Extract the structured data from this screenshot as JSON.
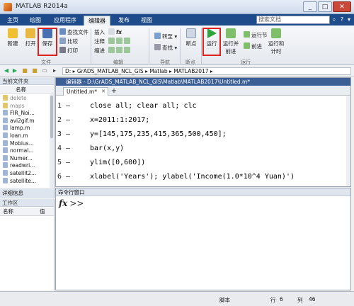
{
  "window": {
    "title": "MATLAB R2014a"
  },
  "tabs": [
    "主页",
    "绘图",
    "应用程序",
    "编辑器",
    "发布",
    "视图"
  ],
  "search": {
    "placeholder": "搜索文档"
  },
  "ribbon": {
    "file": {
      "new": "新建",
      "open": "打开",
      "save": "保存",
      "find_files": "查找文件",
      "compare": "比较",
      "print": "打印",
      "group": "文件"
    },
    "edit": {
      "insert": "插入",
      "comment": "注释",
      "indent": "缩进",
      "fx": "fx",
      "group": "编辑"
    },
    "navigate": {
      "goto": "转至",
      "find": "查找",
      "group": "导航"
    },
    "breakpoints": {
      "breakpoints": "断点",
      "group": "断点"
    },
    "run": {
      "run": "运行",
      "run_advance": "运行并前进",
      "run_section": "运行节",
      "advance": "前进",
      "run_time": "运行和计时",
      "group": "运行"
    }
  },
  "address": {
    "drive": "D:",
    "path": "D: ▸ GrADS_MATLAB_NCL_GIS ▸ Matlab ▸ MATLAB2017 ▸"
  },
  "current_folder": {
    "title": "当前文件夹",
    "column": "名称",
    "items": [
      {
        "name": "delete",
        "type": "folder"
      },
      {
        "name": "maps",
        "type": "folder"
      },
      {
        "name": "FIR_Noi...",
        "type": "file"
      },
      {
        "name": "avi2gif.m",
        "type": "file"
      },
      {
        "name": "lamp.m",
        "type": "file"
      },
      {
        "name": "loan.m",
        "type": "file"
      },
      {
        "name": "Mobius...",
        "type": "file"
      },
      {
        "name": "normal...",
        "type": "file"
      },
      {
        "name": "Numer...",
        "type": "file"
      },
      {
        "name": "readwri...",
        "type": "file"
      },
      {
        "name": "satellit2...",
        "type": "file"
      },
      {
        "name": "satellite...",
        "type": "file"
      }
    ]
  },
  "details": {
    "title": "详细信息"
  },
  "workspace": {
    "title": "工作区",
    "col_name": "名称",
    "col_value": "值"
  },
  "editor": {
    "header": "编辑器 - D:\\GrADS_MATLAB_NCL_GIS\\Matlab\\MATLAB2017\\Untitled.m*",
    "tab": "Untitled.m*",
    "lines": [
      {
        "n": "1",
        "code": "close all; clear all; clc"
      },
      {
        "n": "2",
        "code": "x=2011:1:2017;"
      },
      {
        "n": "3",
        "code": "y=[145,175,235,415,365,500,450];"
      },
      {
        "n": "4",
        "code": "bar(x,y)"
      },
      {
        "n": "5",
        "code": "ylim([0,600])"
      },
      {
        "n": "6",
        "code": "xlabel('Years'); ylabel('Income(1.0*10^4 Yuan)')"
      }
    ]
  },
  "command_window": {
    "title": "命令行窗口",
    "prompt": ">>"
  },
  "status": {
    "script": "脚本",
    "row_label": "行",
    "row": "6",
    "col_label": "列",
    "col": "46"
  }
}
